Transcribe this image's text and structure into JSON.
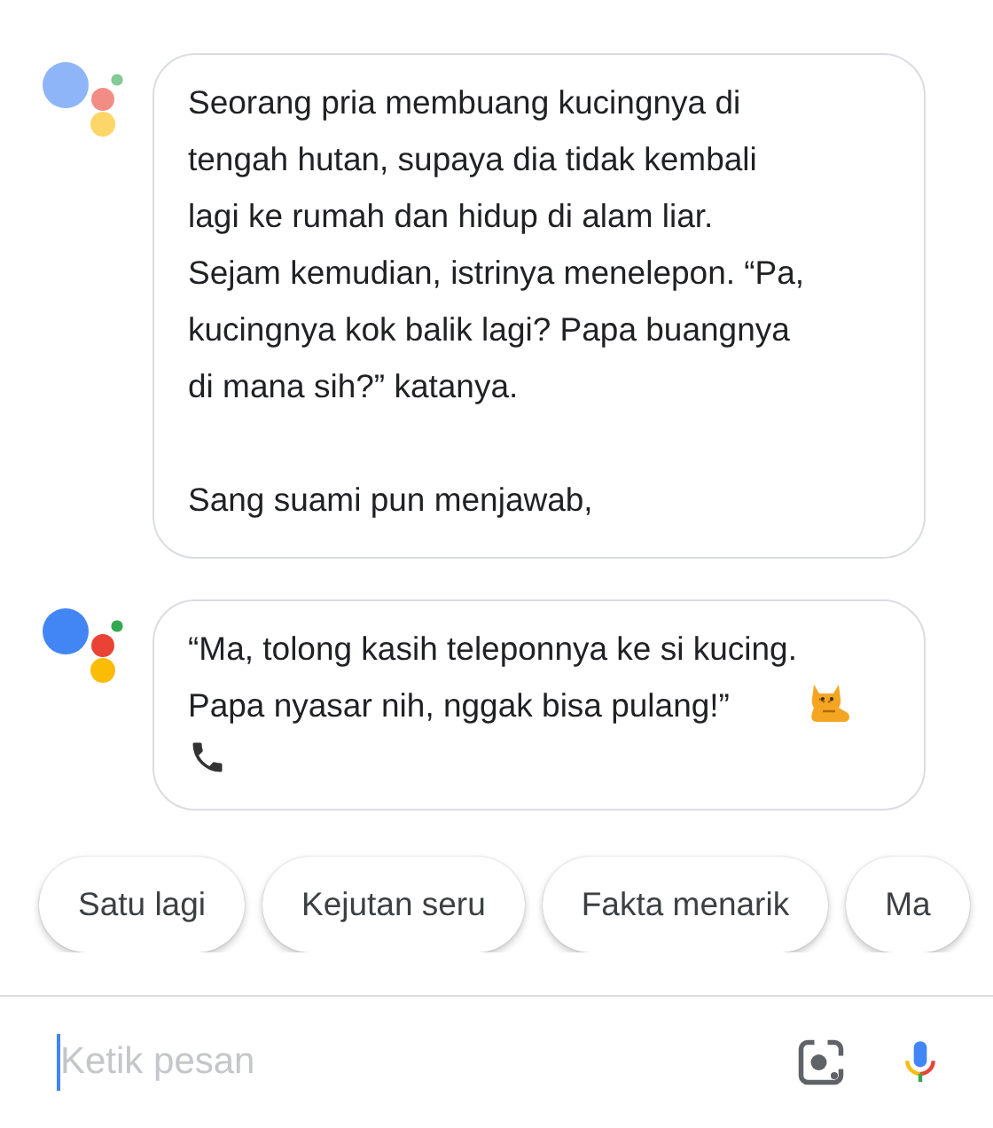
{
  "messages": [
    {
      "active": false,
      "kind": "plain",
      "text": "Seorang pria membuang kucingnya di\ntengah hutan, supaya dia tidak kembali\nlagi ke rumah dan hidup di alam liar.\nSejam kemudian, istrinya menelepon. “Pa,\nkucingnya kok balik lagi? Papa buangnya\ndi mana sih?” katanya.\n\nSang suami pun menjawab,"
    },
    {
      "active": true,
      "kind": "punchline",
      "text": "“Ma, tolong kasih teleponnya ke si kucing.\nPapa nyasar nih, nggak bisa pulang!”"
    }
  ],
  "suggestions": [
    "Satu lagi",
    "Kejutan seru",
    "Fakta menarik",
    "Ma"
  ],
  "input": {
    "placeholder": "Ketik pesan"
  }
}
